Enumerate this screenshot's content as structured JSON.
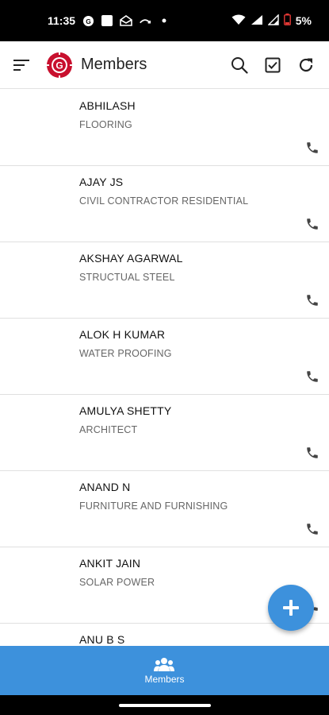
{
  "status_bar": {
    "time": "11:35",
    "battery": "5%"
  },
  "app_bar": {
    "title": "Members",
    "icons": [
      "menu-icon",
      "app-logo",
      "search-icon",
      "checkbox-icon",
      "refresh-icon"
    ]
  },
  "members": [
    {
      "name": "ABHILASH",
      "category": "FLOORING"
    },
    {
      "name": "AJAY JS",
      "category": "CIVIL CONTRACTOR RESIDENTIAL"
    },
    {
      "name": "AKSHAY AGARWAL",
      "category": "STRUCTUAL STEEL"
    },
    {
      "name": "ALOK H KUMAR",
      "category": "WATER PROOFING"
    },
    {
      "name": "AMULYA SHETTY",
      "category": "ARCHITECT"
    },
    {
      "name": "ANAND N",
      "category": "FURNITURE AND FURNISHING"
    },
    {
      "name": "ANKIT JAIN",
      "category": "SOLAR POWER"
    },
    {
      "name": "ANU B S",
      "category": ""
    }
  ],
  "bottom_nav": {
    "label": "Members",
    "icon": "group-icon"
  },
  "colors": {
    "accent": "#3d91dc",
    "logo_red": "#c8102e"
  }
}
